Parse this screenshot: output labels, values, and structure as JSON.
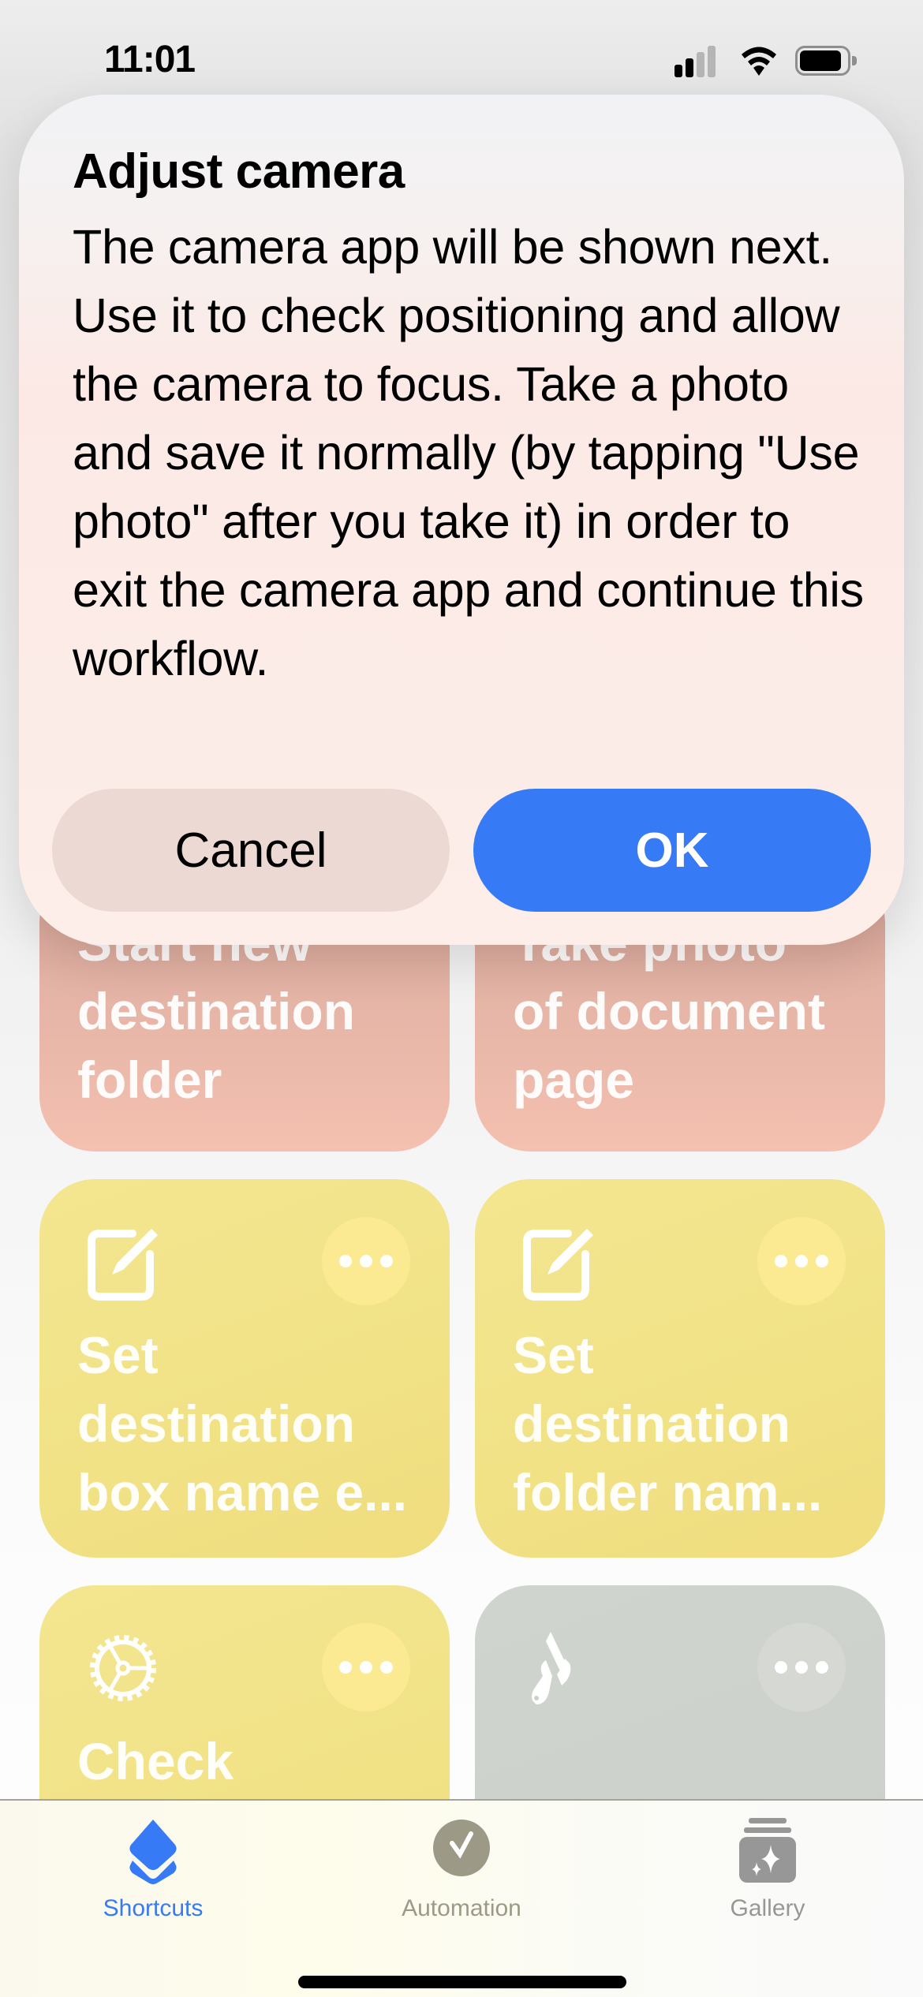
{
  "status_bar": {
    "time": "11:01",
    "signal_icon": "cellular-signal-icon",
    "signal_bars_active": 2,
    "signal_bars_total": 4,
    "wifi_icon": "wifi-icon",
    "battery_icon": "battery-icon"
  },
  "dialog": {
    "title": "Adjust camera",
    "message": "The camera app will be shown next. Use it to check positioning and allow the camera to focus. Take a photo and save it normally (by tapping \"Use photo\" after you take it) in order to exit the camera app and continue this workflow.",
    "cancel_label": "Cancel",
    "ok_label": "OK",
    "ok_color": "#377AF5"
  },
  "shortcuts": [
    {
      "title": "Start new destination folder",
      "lines": [
        "Start new",
        "destination",
        "folder"
      ],
      "color": "#F4C0B0",
      "icon": ""
    },
    {
      "title": "Take photo of document page",
      "lines": [
        "Take photo",
        "of document",
        "page"
      ],
      "color": "#F4C0B0",
      "icon": ""
    },
    {
      "title": "Set destination box name e...",
      "lines": [
        "Set",
        "destination",
        "box name e..."
      ],
      "color": "#F1E286",
      "icon": "compose-icon"
    },
    {
      "title": "Set destination folder nam...",
      "lines": [
        "Set",
        "destination",
        "folder nam..."
      ],
      "color": "#F1E286",
      "icon": "compose-icon"
    },
    {
      "title": "Check",
      "lines": [
        "Check"
      ],
      "color": "#F1E286",
      "icon": "gear-icon"
    },
    {
      "title": "",
      "lines": [],
      "color": "#CBD0CA",
      "icon": "wrench-screwdriver-icon"
    }
  ],
  "tab_bar": {
    "tabs": [
      {
        "label": "Shortcuts",
        "icon": "shortcuts-layers-icon",
        "active": true,
        "color": "#377AF5"
      },
      {
        "label": "Automation",
        "icon": "automation-clock-check-icon",
        "active": false,
        "color": "#9C9A87"
      },
      {
        "label": "Gallery",
        "icon": "gallery-sparkle-icon",
        "active": false,
        "color": "#979797"
      }
    ]
  }
}
